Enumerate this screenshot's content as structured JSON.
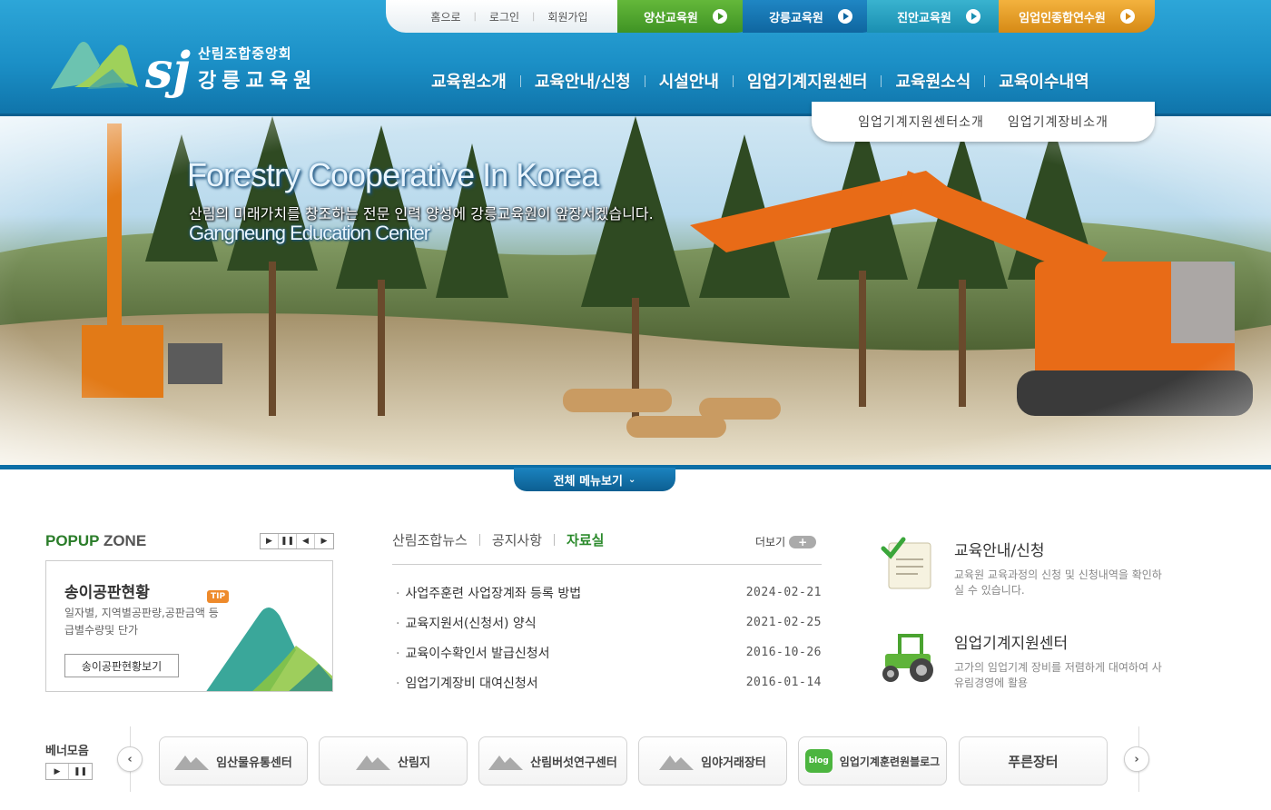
{
  "header": {
    "util_links": [
      "홈으로",
      "로그인",
      "회원가입"
    ],
    "site_tabs": [
      "양산교육원",
      "강릉교육원",
      "진안교육원",
      "임업인종합연수원"
    ],
    "logo": {
      "sub": "산림조합중앙회",
      "main": "강릉교육원",
      "mark": "sj"
    },
    "gnb": [
      "교육원소개",
      "교육안내/신청",
      "시설안내",
      "임업기계지원센터",
      "교육원소식",
      "교육이수내역"
    ],
    "subnav": [
      "임업기계지원센터소개",
      "임업기계장비소개"
    ]
  },
  "hero": {
    "title": "Forestry Cooperative In Korea",
    "subtitle": "산림의 미래가치를 창조하는 전문 인력 양성에 강릉교육원이 앞장서겠습니다.",
    "english": "Gangneung Education Center",
    "menu_button": "전체 메뉴보기"
  },
  "popup": {
    "title_a": "POPUP",
    "title_b": "ZONE",
    "heading": "송이공판현황",
    "tip": "TIP",
    "desc": "일자별, 지역별공판량,공판금액 등급별수량및 단가",
    "button": "송이공판현황보기"
  },
  "board": {
    "tabs": [
      "산림조합뉴스",
      "공지사항",
      "자료실"
    ],
    "active_tab": "자료실",
    "more": "더보기",
    "items": [
      {
        "title": "사업주훈련 사업장계좌 등록 방법",
        "date": "2024-02-21"
      },
      {
        "title": "교육지원서(신청서) 양식",
        "date": "2021-02-25"
      },
      {
        "title": "교육이수확인서 발급신청서",
        "date": "2016-10-26"
      },
      {
        "title": "임업기계장비 대여신청서",
        "date": "2016-01-14"
      }
    ]
  },
  "quick": [
    {
      "title": "교육안내/신청",
      "desc": "교육원 교육과정의 신청 및 신청내역을 확인하실 수 있습니다.",
      "icon": "document-check-icon"
    },
    {
      "title": "임업기계지원센터",
      "desc": "고가의 임업기계 장비를 저렴하게 대여하여 사유림경영에 활용",
      "icon": "tractor-icon"
    }
  ],
  "banners": {
    "title": "베너모음",
    "items": [
      "임산물유통센터",
      "산림지",
      "산림버섯연구센터",
      "임야거래장터",
      "임업기계훈련원블로그",
      "푸른장터"
    ],
    "blog_badge": "blog"
  },
  "colors": {
    "header": "#1b8fc6",
    "green": "#2b8a2c",
    "orange": "#ee8a2b"
  }
}
